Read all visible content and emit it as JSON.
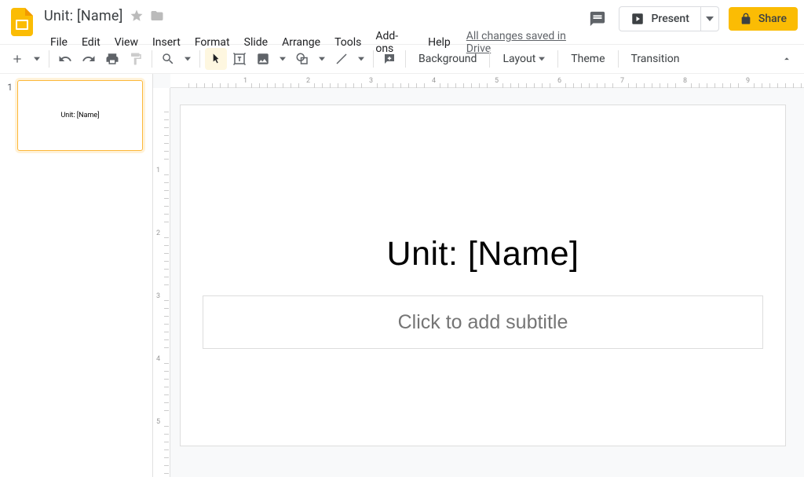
{
  "header": {
    "doc_title": "Unit: [Name]",
    "drive_status": "All changes saved in Drive",
    "present_label": "Present",
    "share_label": "Share"
  },
  "menus": [
    "File",
    "Edit",
    "View",
    "Insert",
    "Format",
    "Slide",
    "Arrange",
    "Tools",
    "Add-ons",
    "Help"
  ],
  "toolbar": {
    "background": "Background",
    "layout": "Layout",
    "theme": "Theme",
    "transition": "Transition"
  },
  "filmstrip": {
    "slides": [
      {
        "number": "1",
        "title": "Unit: [Name]"
      }
    ]
  },
  "canvas": {
    "title_text": "Unit: [Name]",
    "subtitle_placeholder": "Click to add subtitle"
  },
  "ruler_h": [
    "1",
    "2",
    "3",
    "4",
    "5",
    "6",
    "7",
    "8",
    "9"
  ],
  "ruler_v": [
    "1",
    "2",
    "3",
    "4",
    "5"
  ]
}
